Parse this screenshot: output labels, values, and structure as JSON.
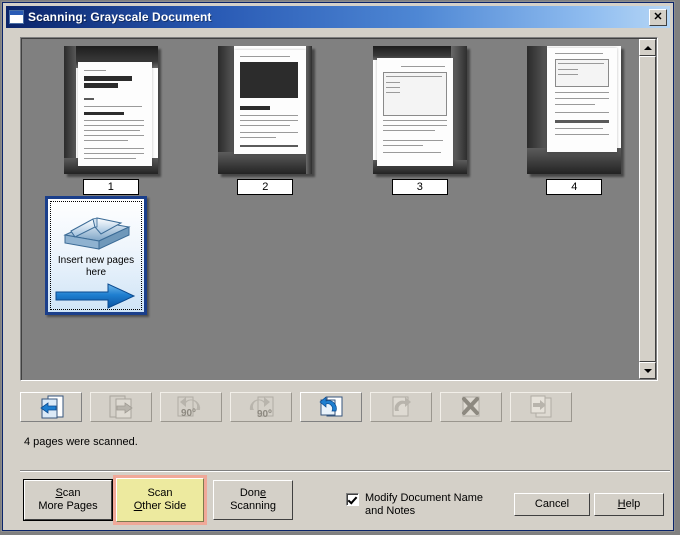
{
  "window": {
    "title": "Scanning: Grayscale Document",
    "icon": "window-icon",
    "close_label": "✕"
  },
  "thumbnails": {
    "pages": [
      {
        "label": "1",
        "alt": "scanned-page-1"
      },
      {
        "label": "2",
        "alt": "scanned-page-2"
      },
      {
        "label": "3",
        "alt": "scanned-page-3"
      },
      {
        "label": "4",
        "alt": "scanned-page-4"
      }
    ],
    "insert_tile": {
      "line1": "Insert new pages",
      "line2": "here",
      "icon": "scanner-icon",
      "arrow": "right-arrow-icon"
    }
  },
  "toolbar": {
    "buttons": [
      {
        "name": "move-page-left-button",
        "icon": "page-left-arrow-icon",
        "enabled": true
      },
      {
        "name": "move-page-right-button",
        "icon": "page-right-arrow-icon",
        "enabled": false
      },
      {
        "name": "rotate-left-90-button",
        "icon": "rotate-ccw-90-icon",
        "enabled": false,
        "degrees": "90º"
      },
      {
        "name": "rotate-right-90-button",
        "icon": "rotate-cw-90-icon",
        "enabled": false,
        "degrees": "90º"
      },
      {
        "name": "rotate-180-button",
        "icon": "rotate-180-icon",
        "enabled": true
      },
      {
        "name": "rescan-page-button",
        "icon": "rescan-page-icon",
        "enabled": false
      },
      {
        "name": "delete-page-button",
        "icon": "delete-x-icon",
        "enabled": false
      },
      {
        "name": "move-pages-to-button",
        "icon": "pages-export-arrow-icon",
        "enabled": false
      }
    ]
  },
  "status": {
    "message": "4 pages were scanned."
  },
  "buttons": {
    "scan_more_line1": "Scan",
    "scan_more_line2": "More Pages",
    "scan_more_accel": "S",
    "scan_other_line1": "Scan",
    "scan_other_line2": "Other Side",
    "scan_other_accel": "O",
    "done_line1": "Done",
    "done_line2": "Scanning",
    "done_accel": "e",
    "cancel": "Cancel",
    "help": "Help",
    "help_accel": "H"
  },
  "checkbox": {
    "label": "Modify Document Name\nand Notes",
    "checked": true
  },
  "scrollbar": {
    "up_arrow": "scroll-up-arrow-icon",
    "down_arrow": "scroll-down-arrow-icon"
  },
  "colors": {
    "title_start": "#0a246a",
    "title_end": "#b6d6f5",
    "panel": "#d4d0c8",
    "canvas": "#808080",
    "highlight_button_bg": "#edea9f",
    "highlight_button_outline": "#f0a898",
    "accent_blue": "#1b70c8"
  }
}
